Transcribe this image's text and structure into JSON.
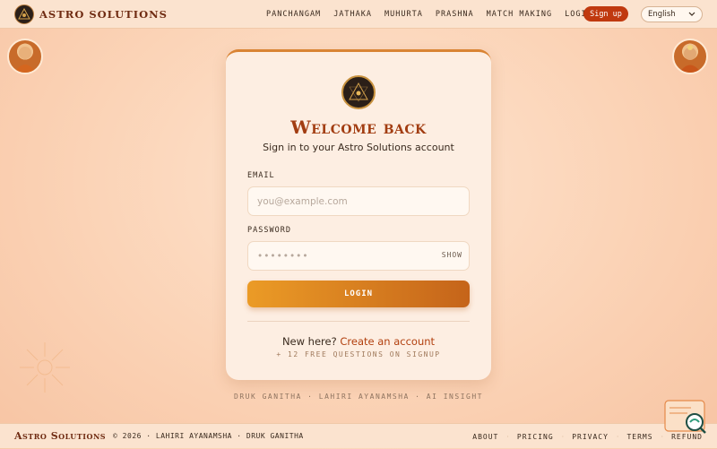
{
  "brand": {
    "name": "ASTRO SOLUTIONS"
  },
  "nav": {
    "items": [
      "PANCHANGAM",
      "JATHAKA",
      "MUHURTA",
      "PRASHNA",
      "MATCH MAKING",
      "LOGIN"
    ],
    "signup": "Sign up",
    "language": "English"
  },
  "login": {
    "title": "Welcome back",
    "subtitle": "Sign in to your Astro Solutions account",
    "email_label": "EMAIL",
    "email_placeholder": "you@example.com",
    "password_label": "PASSWORD",
    "password_mask": "••••••••",
    "show_label": "SHOW",
    "submit_label": "LOGIN",
    "new_here": "New here?",
    "create_link": "Create an account",
    "bonus": "+ 12 FREE QUESTIONS ON SIGNUP"
  },
  "tagline": "DRUK GANITHA · LAHIRI AYANAMSHA · AI INSIGHT",
  "footer": {
    "brand": "Astro Solutions",
    "copy": "© 2026 · LAHIRI AYANAMSHA · DRUK GANITHA",
    "links": [
      "ABOUT",
      "PRICING",
      "PRIVACY",
      "TERMS",
      "REFUND"
    ]
  },
  "colors": {
    "accent": "#c0390f",
    "title": "#a23d12",
    "button_start": "#eb9b26",
    "button_end": "#c5641a"
  },
  "icons": [
    "brand-logo-icon",
    "emblem-icon",
    "chevron-down-icon",
    "chat-icon",
    "sun-icon"
  ]
}
